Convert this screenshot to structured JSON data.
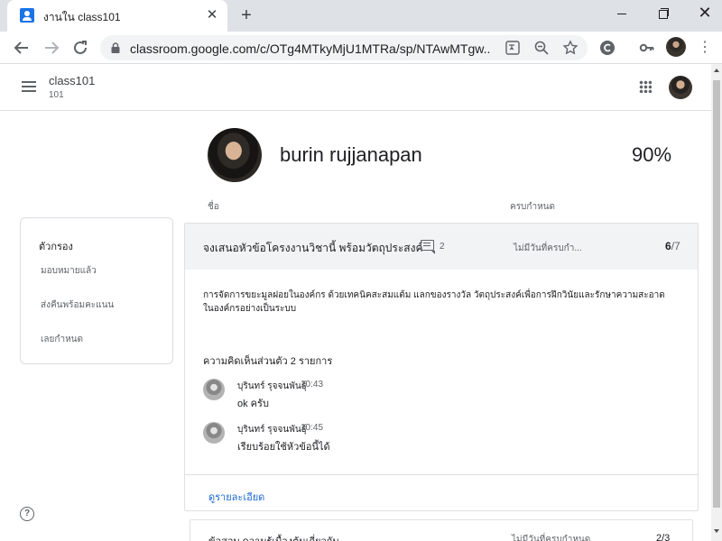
{
  "browser": {
    "tab_title": "งานใน class101",
    "tab_close": "✕",
    "new_tab": "+",
    "window_close": "✕",
    "url": "classroom.google.com/c/OTg4MTkyMjU1MTRa/sp/NTAwMTgw...",
    "menu_glyph": "⋮"
  },
  "app": {
    "class_name": "class101",
    "class_section": "101"
  },
  "student": {
    "name": "burin rujjanapan",
    "percent": "90%"
  },
  "columns": {
    "name": "ชื่อ",
    "due": "ครบกำหนด"
  },
  "filter": {
    "title": "ตัวกรอง",
    "items": [
      "มอบหมายแล้ว",
      "ส่งคืนพร้อมคะแนน",
      "เลยกำหนด"
    ]
  },
  "assignment": {
    "title": "จงเสนอหัวข้อโครงงานวิชานี้ พร้อมวัตถุประสงค์",
    "comment_count": "2",
    "due": "ไม่มีวันที่ครบกำ...",
    "score": "6",
    "score_max": "/7",
    "description": "การจัดการขยะมูลฝอยในองค์กร ด้วยเทคนิคสะสมแต้ม แลกของรางวัล วัตถุประสงค์เพื่อการฝึกวินัยและรักษาความสะอาดในองค์กรอย่างเป็นระบบ",
    "private_comments_title": "ความคิดเห็นส่วนตัว 2 รายการ",
    "comments": [
      {
        "author": "บุรินทร์ รุจจนพันธุ์",
        "time": "10:43",
        "text": "ok ครับ"
      },
      {
        "author": "บุรินทร์ รุจจนพันธุ์",
        "time": "10:45",
        "text": "เรียบร้อยใช้หัวข้อนี้ได้"
      }
    ],
    "details_link": "ดูรายละเอียด"
  },
  "next_assignment": {
    "title": "ข้อสอบ ความรู้เบื้องต้นเกี่ยวกับ...",
    "due": "ไม่มีวันที่ครบกำหนด",
    "score": "2/3"
  },
  "help": "?",
  "colors": {
    "accent": "#1a73e8",
    "link": "#1967d2",
    "header_bg": "#f1f3f4"
  }
}
